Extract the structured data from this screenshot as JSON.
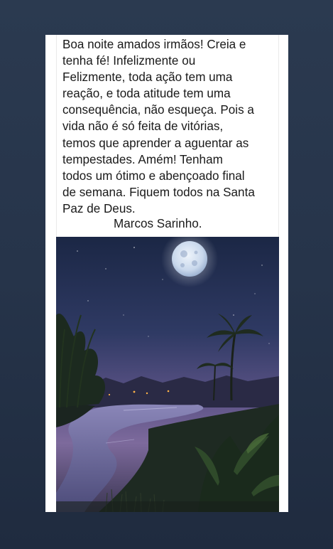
{
  "post": {
    "lines": [
      "Boa noite amados irmãos! Creia e",
      "tenha fé! Infelizmente ou",
      "Felizmente, toda ação tem uma",
      "reação, e toda atitude tem uma",
      "consequência, não esqueça. Pois a",
      "vida não é só feita de vitórias,",
      "temos que aprender a aguentar as",
      "tempestades. Amém! Tenham",
      "todos um ótimo e abençoado final",
      "de semana. Fiquem todos na Santa",
      "Paz de Deus."
    ],
    "signature": "Marcos Sarinho."
  },
  "colors": {
    "page_background": "#26344a",
    "card_background": "#ffffff",
    "text": "#1a1a1a",
    "sky_top": "#1b2745",
    "sky_horizon": "#7d6a9c",
    "moon": "#d9e6f5"
  }
}
